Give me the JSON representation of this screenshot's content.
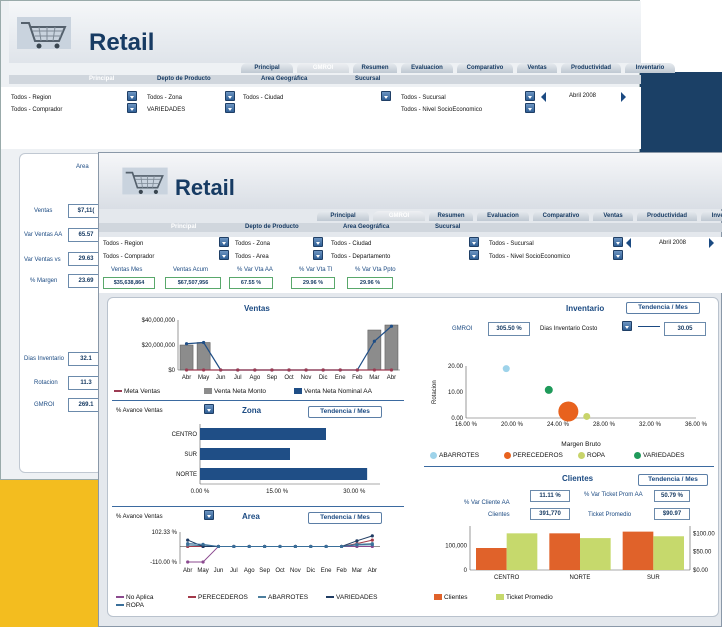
{
  "app": {
    "logo_text": "Retail"
  },
  "tabs": [
    "Principal",
    "GMROI",
    "Resumen",
    "Evaluacion",
    "Comparativo",
    "Ventas",
    "Productividad",
    "Inventario"
  ],
  "back": {
    "subtabs": [
      "Principal",
      "Depto de Producto",
      "Area Geográfica",
      "Sucursal"
    ],
    "filters": {
      "region": "Todos - Region",
      "zona": "Todos - Zona",
      "ciudad": "Todos - Ciudad",
      "sucursal": "Todos - Sucursal",
      "comprador": "Todos - Comprador",
      "variedades": "VARIEDADES",
      "nivel": "Todos - Nivel SocioEconomico",
      "period": "Abril 2008"
    },
    "kpi_header": "Area",
    "kpis": [
      {
        "label": "Ventas",
        "value": "$7,11("
      },
      {
        "label": "Var Ventas AA",
        "value": "65.57"
      },
      {
        "label": "Var Ventas vs",
        "value": "29.63"
      },
      {
        "label": "% Margen",
        "value": "23.69"
      }
    ],
    "kpis2": [
      {
        "label": "Dias Inventario",
        "value": "32.1"
      },
      {
        "label": "Rotacion",
        "value": "11.3"
      },
      {
        "label": "GMROI",
        "value": "269.1"
      }
    ]
  },
  "front": {
    "subtabs": [
      "Principal",
      "Depto de Producto",
      "Area Geográfica",
      "Sucursal"
    ],
    "filters": {
      "region": "Todos - Region",
      "zona": "Todos - Zona",
      "ciudad": "Todos - Ciudad",
      "sucursal": "Todos - Sucursal",
      "comprador": "Todos - Comprador",
      "area": "Todos - Area",
      "departamento": "Todos - Departamento",
      "nivel": "Todos - Nivel SocioEconomico",
      "period": "Abril 2008"
    },
    "kpis": [
      {
        "label": "Ventas Mes",
        "value": "$35,638,864"
      },
      {
        "label": "Ventas Acum",
        "value": "$67,507,956"
      },
      {
        "label": "% Var Vta AA",
        "value": "67.55 %"
      },
      {
        "label": "% Var Vta TI",
        "value": "29.96 %"
      },
      {
        "label": "% Var Vta Ppto",
        "value": "29.96 %"
      }
    ],
    "ventas": {
      "title": "Ventas"
    },
    "inventario": {
      "title": "Inventario",
      "tendencia": "Tendencia / Mes",
      "gmroi_label": "GMROI",
      "gmroi_value": "305.50 %",
      "dias_label": "Dias Inventario Costo",
      "dias_value": "30.05"
    },
    "zona": {
      "title": "Zona",
      "avance": "% Avance Ventas",
      "tendencia": "Tendencia / Mes"
    },
    "area": {
      "title": "Area",
      "avance": "% Avance Ventas",
      "tendencia": "Tendencia / Mes"
    },
    "clientes": {
      "title": "Clientes",
      "tendencia": "Tendencia / Mes",
      "var_cliente_label": "% Var Cliente AA",
      "var_cliente_value": "11.11 %",
      "var_ticket_label": "% Var Ticket Prom AA",
      "var_ticket_value": "50.79 %",
      "clientes_label": "Clientes",
      "clientes_value": "391,770",
      "ticket_label": "Ticket Promedio",
      "ticket_value": "$90.97"
    }
  },
  "chart_data": [
    {
      "type": "bar",
      "name": "ventas",
      "categories": [
        "Abr",
        "May",
        "Jun",
        "Jul",
        "Ago",
        "Sep",
        "Oct",
        "Nov",
        "Dic",
        "Ene",
        "Feb",
        "Mar",
        "Abr"
      ],
      "yticks": [
        "$40,000,000",
        "$20,000,000",
        "$0"
      ],
      "ylim": [
        0,
        40000000
      ],
      "series": [
        {
          "name": "Meta Ventas",
          "type": "line",
          "color": "#9c3b52",
          "values": [
            0,
            0,
            0,
            0,
            0,
            0,
            0,
            0,
            0,
            0,
            0,
            0,
            0
          ]
        },
        {
          "name": "Venta Neta Monto",
          "type": "bar",
          "color": "#8c8c8c",
          "values": [
            20000000,
            22000000,
            0,
            0,
            0,
            0,
            0,
            0,
            0,
            0,
            0,
            32000000,
            36000000
          ]
        },
        {
          "name": "Venta Neta Nominal AA",
          "type": "line",
          "color": "#1f4e86",
          "values": [
            21000000,
            22000000,
            0,
            0,
            0,
            0,
            0,
            0,
            0,
            0,
            0,
            23000000,
            35000000
          ]
        }
      ]
    },
    {
      "type": "scatter",
      "name": "inventario",
      "xlabel": "Margen Bruto",
      "ylabel": "Rotacion",
      "xticks": [
        "16.00 %",
        "20.00 %",
        "24.00 %",
        "28.00 %",
        "32.00 %",
        "36.00 %"
      ],
      "yticks": [
        "20.00",
        "10.00",
        "0.00"
      ],
      "xlim": [
        16,
        36
      ],
      "ylim": [
        0,
        20
      ],
      "series": [
        {
          "name": "ABARROTES",
          "color": "#9ed3ea",
          "x": 19.5,
          "y": 19.0,
          "size": 5
        },
        {
          "name": "PERECEDEROS",
          "color": "#e8621e",
          "x": 24.9,
          "y": 2.5,
          "size": 18
        },
        {
          "name": "ROPA",
          "color": "#c8d46a",
          "x": 26.5,
          "y": 0.6,
          "size": 5
        },
        {
          "name": "VARIEDADES",
          "color": "#1f9a5a",
          "x": 23.2,
          "y": 10.8,
          "size": 6
        }
      ]
    },
    {
      "type": "bar",
      "name": "zona",
      "orientation": "horizontal",
      "categories": [
        "CENTRO",
        "SUR",
        "NORTE"
      ],
      "values": [
        24.5,
        17.5,
        32.5
      ],
      "xticks": [
        "0.00 %",
        "15.00 %",
        "30.00 %"
      ],
      "xlim": [
        0,
        35
      ],
      "color": "#1f4e86"
    },
    {
      "type": "line",
      "name": "area",
      "categories": [
        "Abr",
        "May",
        "Jun",
        "Jul",
        "Ago",
        "Sep",
        "Oct",
        "Nov",
        "Dic",
        "Ene",
        "Feb",
        "Mar",
        "Abr"
      ],
      "yticks": [
        "102.33 %",
        "-110.00 %"
      ],
      "ylim": [
        -110,
        102.33
      ],
      "series": [
        {
          "name": "No Aplica",
          "color": "#8b4a8f",
          "values": [
            -110,
            -110,
            0,
            0,
            0,
            0,
            0,
            0,
            0,
            0,
            0,
            0,
            0
          ]
        },
        {
          "name": "PERECEDEROS",
          "color": "#a33a4a",
          "values": [
            0,
            0,
            0,
            0,
            0,
            0,
            0,
            0,
            0,
            0,
            0,
            20,
            45
          ]
        },
        {
          "name": "ABARROTES",
          "color": "#4d7f9e",
          "values": [
            10,
            5,
            0,
            0,
            0,
            0,
            0,
            0,
            0,
            0,
            0,
            15,
            20
          ]
        },
        {
          "name": "VARIEDADES",
          "color": "#1f3c63",
          "values": [
            45,
            0,
            0,
            0,
            0,
            0,
            0,
            0,
            0,
            0,
            0,
            40,
            75
          ]
        },
        {
          "name": "ROPA",
          "color": "#3a6f9a",
          "values": [
            20,
            15,
            0,
            0,
            0,
            0,
            0,
            0,
            0,
            0,
            0,
            10,
            12
          ]
        }
      ]
    },
    {
      "type": "bar",
      "name": "clientes",
      "categories": [
        "CENTRO",
        "NORTE",
        "SUR"
      ],
      "yticks_left": [
        "100,000",
        "0"
      ],
      "yticks_right": [
        "$100.00",
        "$50.00",
        "$0.00"
      ],
      "series": [
        {
          "name": "Clientes",
          "color": "#e0622a",
          "axis": "left",
          "values": [
            90000,
            150000,
            157000
          ]
        },
        {
          "name": "Ticket Promedio",
          "color": "#c6d96c",
          "axis": "right",
          "values": [
            100,
            87,
            92
          ]
        }
      ],
      "ylim_left": [
        0,
        180000
      ],
      "ylim_right": [
        0,
        120
      ]
    }
  ]
}
